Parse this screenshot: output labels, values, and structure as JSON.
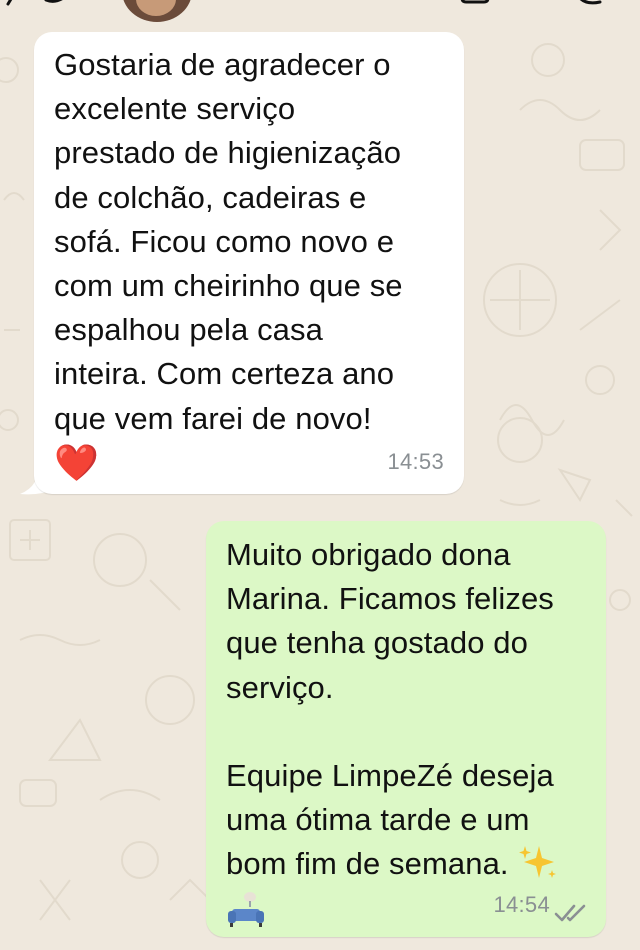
{
  "chat": {
    "messages": [
      {
        "direction": "incoming",
        "text": "Gostaria de agradecer o\nexcelente serviço\nprestado de higienização\nde colchão, cadeiras e\nsofá. Ficou como novo e\ncom um cheirinho que se\nespalhou pela casa\ninteira. Com certeza ano\nque vem farei de novo!",
        "emoji": "❤️",
        "time": "14:53"
      },
      {
        "direction": "outgoing",
        "text": "Muito obrigado dona\nMarina. Ficamos felizes\nque tenha gostado do\nserviço.\n\nEquipe LimpeZé deseja\numa ótima tarde e um\nbom fim de semana.",
        "time": "14:54",
        "status": "read"
      }
    ]
  },
  "icons": {
    "back": "chevron-left-icon",
    "video": "video-call-icon",
    "call": "phone-icon",
    "sparkles": "sparkles-emoji",
    "sofa": "couch-emoji",
    "ticks": "double-check-icon"
  },
  "colors": {
    "wallpaper": "#efe8dd",
    "incoming_bubble": "#ffffff",
    "outgoing_bubble": "#dcf8c6",
    "timestamp": "#8a8f93",
    "read_ticks": "#8a8f93"
  }
}
